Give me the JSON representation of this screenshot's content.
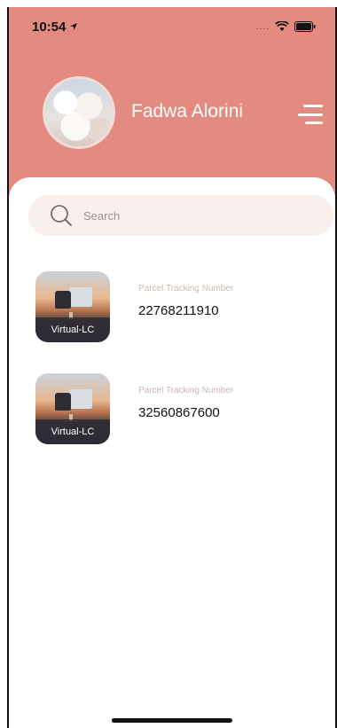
{
  "status_bar": {
    "time": "10:54",
    "signal": "....",
    "icons": [
      "location-arrow-icon",
      "wifi-icon",
      "battery-icon"
    ]
  },
  "header": {
    "user_name": "Fadwa Alorini",
    "menu_icon": "hamburger-menu-icon",
    "background_color": "#e38b80"
  },
  "search": {
    "placeholder": "Search",
    "value": ""
  },
  "parcels": [
    {
      "image_label": "Virtual-LC",
      "caption": "Parcel Tracking Number",
      "tracking_number": "22768211910"
    },
    {
      "image_label": "Virtual-LC",
      "caption": "Parcel Tracking Number",
      "tracking_number": "32560867600"
    }
  ]
}
